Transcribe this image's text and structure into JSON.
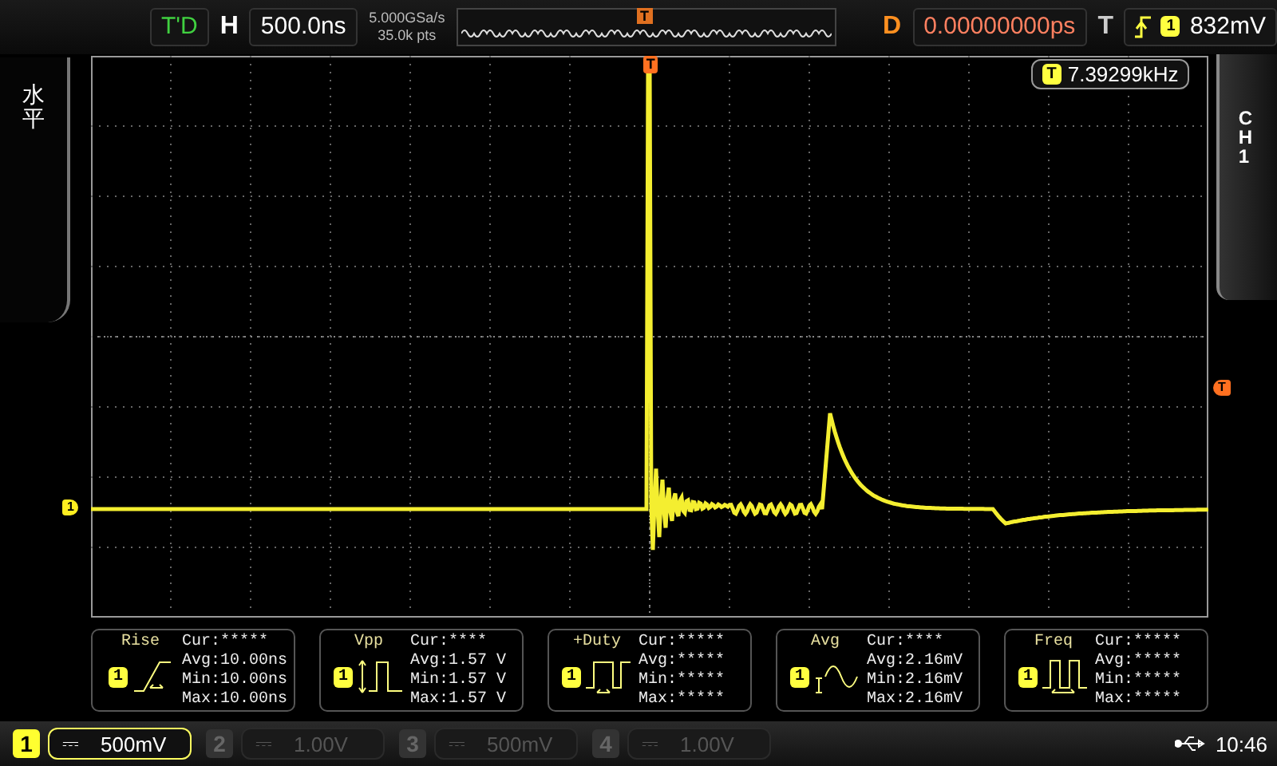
{
  "status": "T'D",
  "timebase": {
    "label": "H",
    "value": "500.0ns"
  },
  "sampling": {
    "rate": "5.000GSa/s",
    "depth": "35.0k pts"
  },
  "memory_marker": "T",
  "delay": {
    "label": "D",
    "value": "0.00000000ps"
  },
  "trigger": {
    "label": "T",
    "channel": "1",
    "level": "832mV"
  },
  "side_label": "水平",
  "channel_tab": "CH1",
  "frequency": {
    "marker": "T",
    "value": "7.39299kHz"
  },
  "trigger_position_marker": "T",
  "ground_marker": "1",
  "trigger_level_marker": "T",
  "measurements": [
    {
      "kind": "rise",
      "title": "Rise",
      "channel": "1",
      "lines": [
        "Cur:*****",
        "Avg:10.00ns",
        "Min:10.00ns",
        "Max:10.00ns"
      ]
    },
    {
      "kind": "vpp",
      "title": "Vpp",
      "channel": "1",
      "lines": [
        "Cur:****",
        "Avg:1.57 V",
        "Min:1.57 V",
        "Max:1.57 V"
      ]
    },
    {
      "kind": "duty",
      "title": "+Duty",
      "channel": "1",
      "lines": [
        "Cur:*****",
        "Avg:*****",
        "Min:*****",
        "Max:*****"
      ]
    },
    {
      "kind": "avg",
      "title": "Avg",
      "channel": "1",
      "lines": [
        "Cur:****",
        "Avg:2.16mV",
        "Min:2.16mV",
        "Max:2.16mV"
      ]
    },
    {
      "kind": "freq",
      "title": "Freq",
      "channel": "1",
      "lines": [
        "Cur:*****",
        "Avg:*****",
        "Min:*****",
        "Max:*****"
      ]
    }
  ],
  "channels": [
    {
      "number": "1",
      "coupling": "⎓",
      "scale": "500mV",
      "selected": true
    },
    {
      "number": "2",
      "coupling": "⎓",
      "scale": "1.00V",
      "selected": false
    },
    {
      "number": "3",
      "coupling": "⎓",
      "scale": "500mV",
      "selected": false
    },
    {
      "number": "4",
      "coupling": "⎓",
      "scale": "1.00V",
      "selected": false
    }
  ],
  "clock": "10:46"
}
